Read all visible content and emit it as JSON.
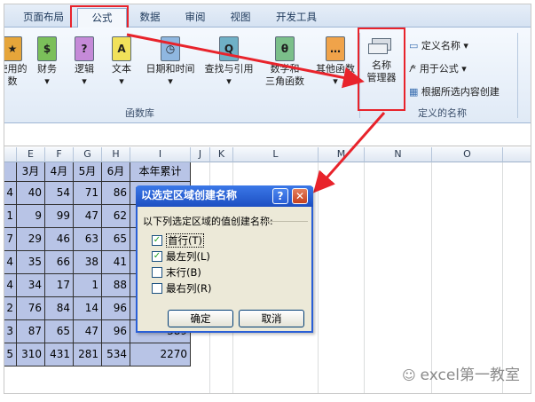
{
  "tabs": [
    "页面布局",
    "公式",
    "数据",
    "审阅",
    "视图",
    "开发工具"
  ],
  "ribbon": {
    "buttons": [
      {
        "label": "使用的",
        "sub": "数",
        "icon": "★"
      },
      {
        "label": "财务",
        "sub": "",
        "icon": "$"
      },
      {
        "label": "逻辑",
        "sub": "",
        "icon": "?"
      },
      {
        "label": "文本",
        "sub": "",
        "icon": "A"
      },
      {
        "label": "日期和时间",
        "sub": "",
        "icon": "◷"
      },
      {
        "label": "查找与引用",
        "sub": "",
        "icon": "Q"
      },
      {
        "label": "数学和",
        "sub": "三角函数",
        "icon": "θ"
      },
      {
        "label": "其他函数",
        "sub": "",
        "icon": "…"
      }
    ],
    "group_function_lib": "函数库",
    "name_manager": {
      "line1": "名称",
      "line2": "管理器"
    },
    "define_name": "定义名称",
    "use_in_formula": "用于公式",
    "create_from_selection": "根据所选内容创建",
    "group_defined_names": "定义的名称"
  },
  "columns": [
    "E",
    "F",
    "G",
    "H",
    "I",
    "J",
    "K",
    "L",
    "M",
    "N",
    "O"
  ],
  "table": {
    "headers": [
      "3月",
      "4月",
      "5月",
      "6月",
      "本年累计"
    ],
    "rows": [
      [
        "4",
        "40",
        "54",
        "71",
        "86"
      ],
      [
        "1",
        "9",
        "99",
        "47",
        "62"
      ],
      [
        "7",
        "29",
        "46",
        "63",
        "65"
      ],
      [
        "4",
        "35",
        "66",
        "38",
        "41"
      ],
      [
        "4",
        "34",
        "17",
        "1",
        "88"
      ],
      [
        "2",
        "76",
        "84",
        "14",
        "96"
      ],
      [
        "3",
        "87",
        "65",
        "47",
        "96",
        "389"
      ],
      [
        "5",
        "310",
        "431",
        "281",
        "534",
        "2270"
      ]
    ]
  },
  "dialog": {
    "title": "以选定区域创建名称",
    "help": "?",
    "close": "✕",
    "prompt": "以下列选定区域的值创建名称:",
    "options": [
      {
        "label": "首行(T)",
        "checked": "✓"
      },
      {
        "label": "最左列(L)",
        "checked": "✓"
      },
      {
        "label": "末行(B)",
        "checked": ""
      },
      {
        "label": "最右列(R)",
        "checked": ""
      }
    ],
    "ok": "确定",
    "cancel": "取消"
  },
  "watermark": "excel第一教室",
  "colors": {
    "accent": "#e8232b",
    "selection": "#b8c4e6",
    "titlebar": "#2a5fd6"
  }
}
